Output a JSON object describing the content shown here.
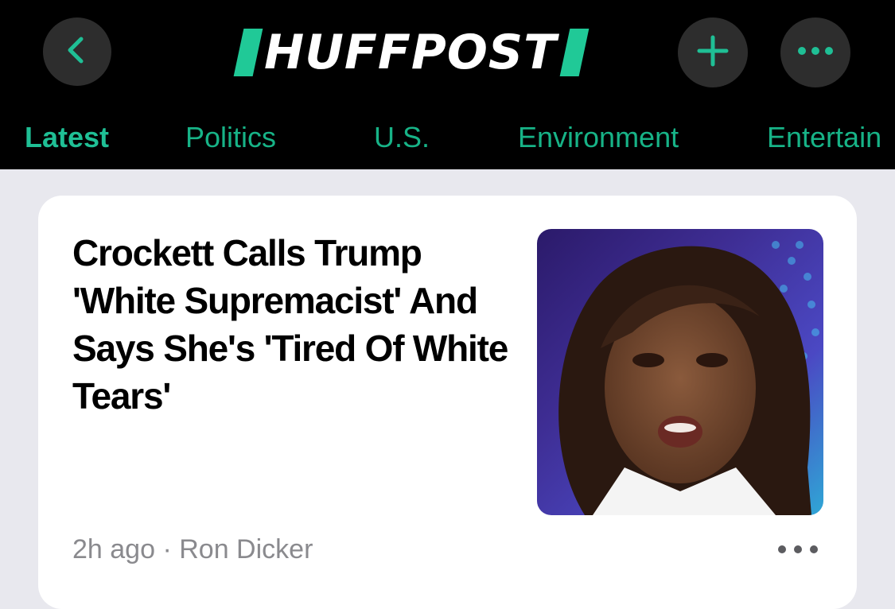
{
  "app": {
    "logo_text": "HUFFPOST",
    "accent_color": "#20c997"
  },
  "nav": {
    "back_icon": "chevron-left-icon",
    "add_icon": "plus-icon",
    "more_icon": "ellipsis-icon"
  },
  "tabs": [
    {
      "label": "Latest",
      "active": true
    },
    {
      "label": "Politics",
      "active": false
    },
    {
      "label": "U.S.",
      "active": false
    },
    {
      "label": "Environment",
      "active": false
    },
    {
      "label": "Entertain",
      "active": false
    }
  ],
  "article": {
    "headline": "Crockett Calls Trump 'White Supremacist' And Says She's 'Tired Of White Tears'",
    "time": "2h ago",
    "separator": "·",
    "author": "Ron Dicker"
  }
}
